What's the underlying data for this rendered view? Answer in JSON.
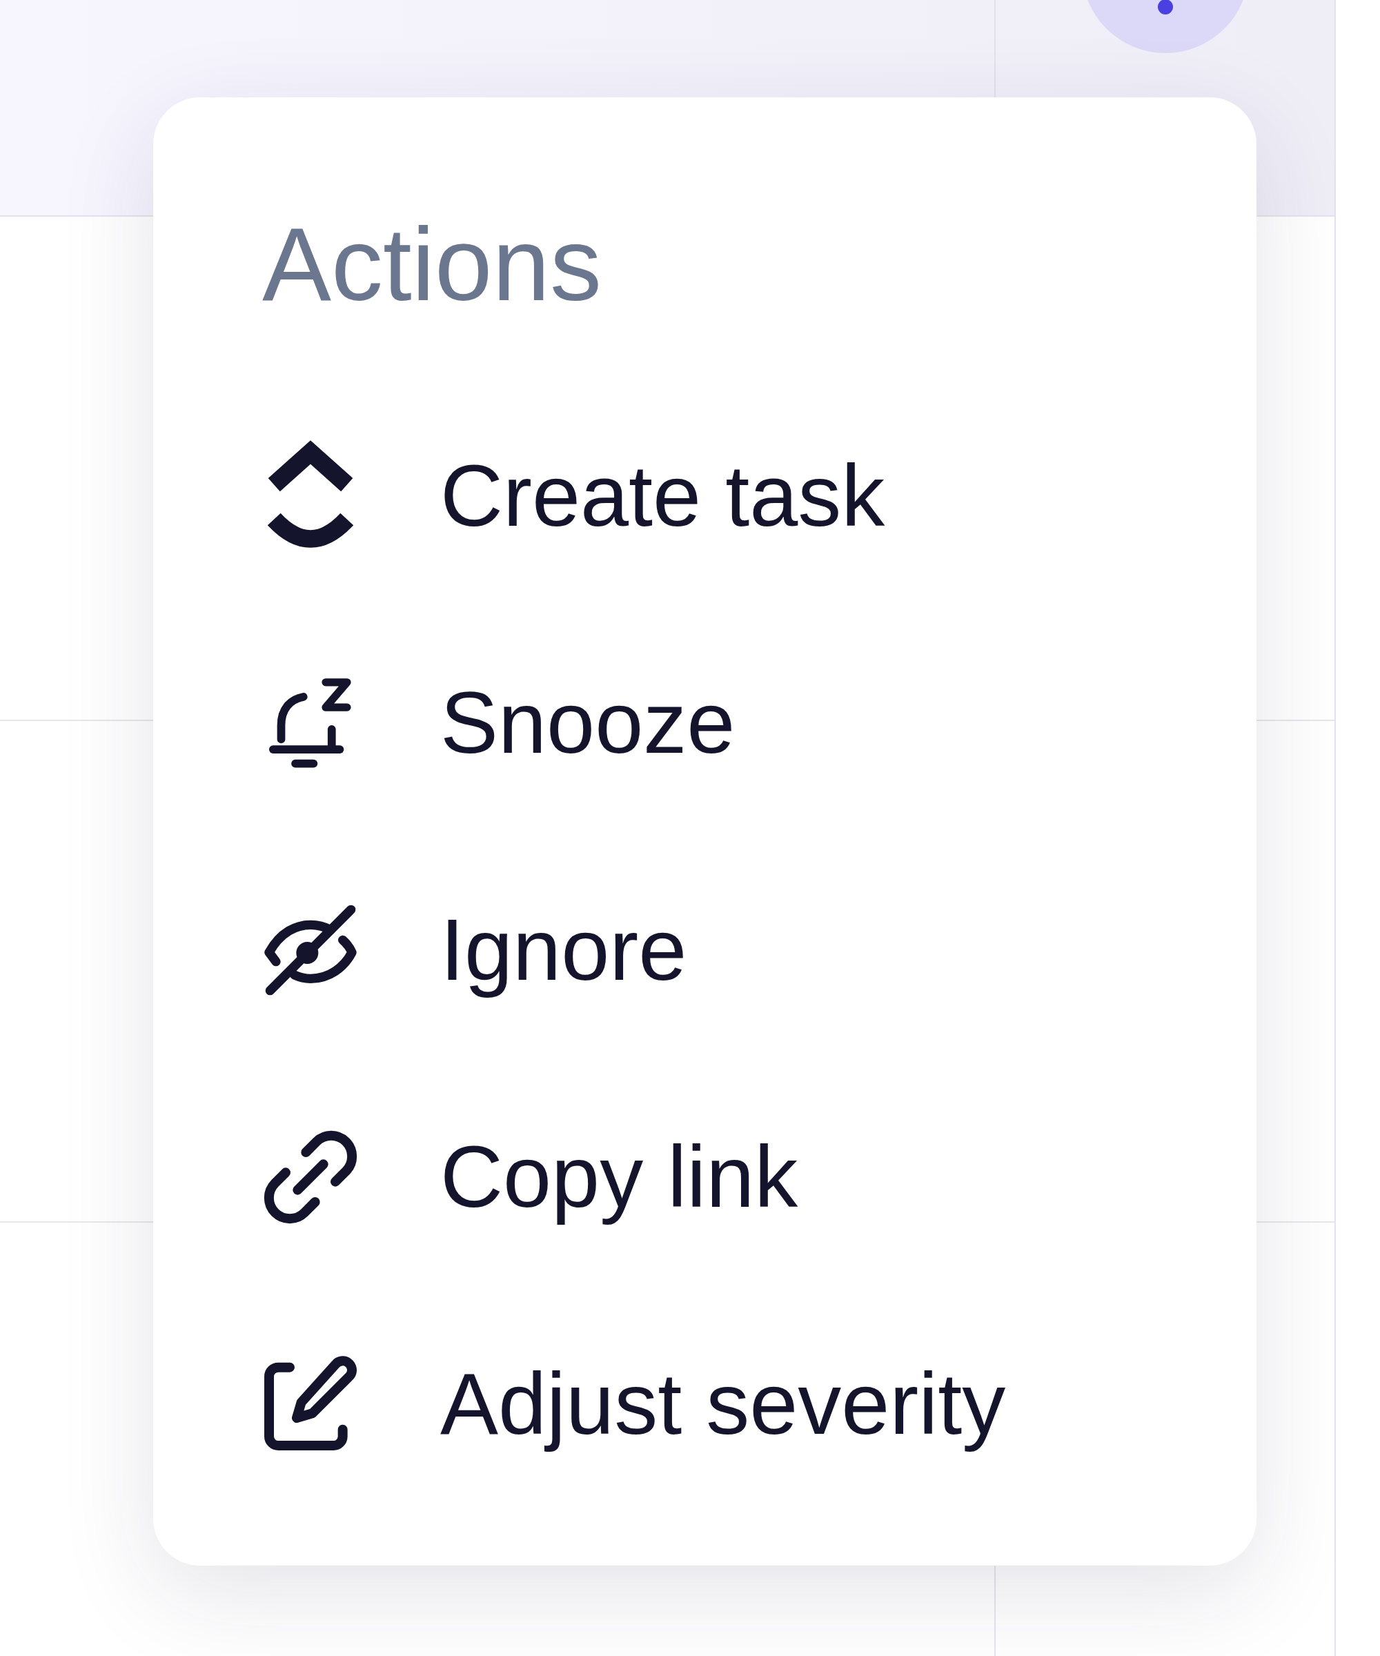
{
  "menu": {
    "title": "Actions",
    "items": [
      {
        "label": "Create task",
        "kind": "task"
      },
      {
        "label": "Snooze",
        "kind": "snooze"
      },
      {
        "label": "Ignore",
        "kind": "ignore"
      },
      {
        "label": "Copy link",
        "kind": "link"
      },
      {
        "label": "Adjust severity",
        "kind": "edit"
      }
    ]
  }
}
